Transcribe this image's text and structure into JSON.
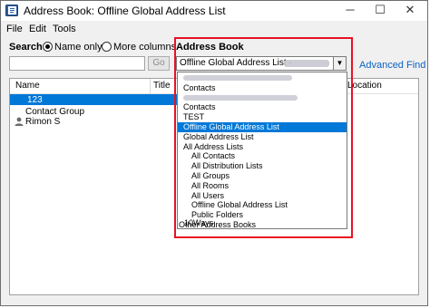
{
  "window": {
    "title": "Address Book: Offline Global Address List",
    "controls": {
      "minimize": "─",
      "maximize": "☐",
      "close": "✕"
    }
  },
  "menu": {
    "items": [
      "File",
      "Edit",
      "Tools"
    ]
  },
  "search": {
    "label": "Search:",
    "options": [
      {
        "label": "Name only",
        "selected": true
      },
      {
        "label": "More columns",
        "selected": false
      }
    ],
    "input_value": "",
    "go_label": "Go"
  },
  "address_book": {
    "label": "Address Book",
    "selected_value": "Offline Global Address List -",
    "advanced_find_label": "Advanced Find"
  },
  "list": {
    "columns": [
      "Name",
      "Title",
      "Location"
    ],
    "rows": [
      {
        "name": "123",
        "selected": true
      },
      {
        "name": "Contact Group",
        "selected": false
      },
      {
        "name": "Rimon S",
        "selected": false
      }
    ]
  },
  "dropdown": {
    "items": [
      {
        "label": "",
        "level": 0
      },
      {
        "label": "Contacts",
        "level": 0
      },
      {
        "label": "",
        "level": 0
      },
      {
        "label": "Contacts",
        "level": 0
      },
      {
        "label": "TEST",
        "level": 0
      },
      {
        "label": "Offline Global Address List",
        "level": 0,
        "selected": true
      },
      {
        "label": "Global Address List",
        "level": 0
      },
      {
        "label": "All Address Lists",
        "level": 0
      },
      {
        "label": "All Contacts",
        "level": 1
      },
      {
        "label": "All Distribution Lists",
        "level": 1
      },
      {
        "label": "All Groups",
        "level": 1
      },
      {
        "label": "All Rooms",
        "level": 1
      },
      {
        "label": "All Users",
        "level": 1
      },
      {
        "label": "Offline Global Address List",
        "level": 1
      },
      {
        "label": "Public Folders",
        "level": 1
      },
      {
        "label": "Other Address Books",
        "level": 0
      },
      {
        "label": "10Ways",
        "level": 1
      }
    ]
  },
  "colors": {
    "selection": "#0078d7",
    "highlight_border": "#e81123",
    "link": "#0b63c3"
  },
  "icons": [
    "address-book-icon",
    "person-icon",
    "chevron-down-icon"
  ]
}
